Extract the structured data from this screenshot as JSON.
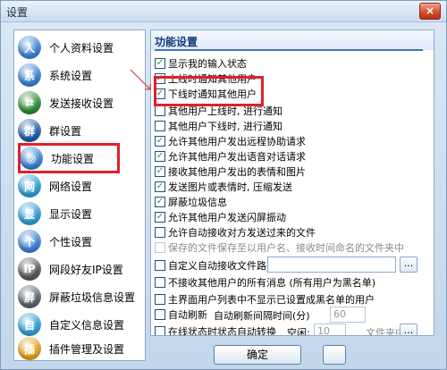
{
  "window": {
    "title": "设置",
    "close_glyph": "×"
  },
  "sidebar": {
    "items": [
      {
        "label": "个人资料设置",
        "icon": "person-icon",
        "color": "#3b83d6",
        "glyph": "人"
      },
      {
        "label": "系统设置",
        "icon": "system-icon",
        "color": "#3b83d6",
        "glyph": "系"
      },
      {
        "label": "发送接收设置",
        "icon": "send-receive-icon",
        "color": "#2f8c3a",
        "glyph": "⇄"
      },
      {
        "label": "群设置",
        "icon": "group-icon",
        "color": "#1d5fad",
        "glyph": "群"
      },
      {
        "label": "功能设置",
        "icon": "function-icon",
        "color": "#3b83d6",
        "glyph": "◎"
      },
      {
        "label": "网络设置",
        "icon": "network-icon",
        "color": "#2f9fd6",
        "glyph": "网"
      },
      {
        "label": "显示设置",
        "icon": "display-icon",
        "color": "#2f9fd6",
        "glyph": "显"
      },
      {
        "label": "个性设置",
        "icon": "personalize-icon",
        "color": "#3b83d6",
        "glyph": "个"
      },
      {
        "label": "网段好友IP设置",
        "icon": "ip-icon",
        "color": "#5a5a5a",
        "glyph": "IP"
      },
      {
        "label": "屏蔽垃圾信息设置",
        "icon": "block-spam-icon",
        "color": "#5a6470",
        "glyph": "屏"
      },
      {
        "label": "自定义信息设置",
        "icon": "custom-info-icon",
        "color": "#2f9fd6",
        "glyph": "自"
      },
      {
        "label": "插件管理及设置",
        "icon": "plugin-icon",
        "color": "#e5a21f",
        "glyph": "插"
      }
    ],
    "selected_index": 4
  },
  "panel": {
    "title": "功能设置",
    "options": [
      {
        "label": "显示我的输入状态",
        "checked": true
      },
      {
        "label": "上线时通知其他用户",
        "checked": true
      },
      {
        "label": "下线时通知其他用户",
        "checked": true
      },
      {
        "label": "其他用户上线时, 进行通知",
        "checked": false
      },
      {
        "label": "其他用户下线时, 进行通知",
        "checked": false
      },
      {
        "label": "允许其他用户发出远程协助请求",
        "checked": true
      },
      {
        "label": "允许其他用户发出语音对话请求",
        "checked": true
      },
      {
        "label": "接收其他用户发出的表情和图片",
        "checked": true
      },
      {
        "label": "发送图片或表情时, 压缩发送",
        "checked": true
      },
      {
        "label": "屏蔽垃圾信息",
        "checked": true
      },
      {
        "label": "允许其他用户发送闪屏振动",
        "checked": true
      },
      {
        "label": "允许自动接收对方发送过来的文件",
        "checked": false
      },
      {
        "label": "保存的文件保存至以用户名、接收时间命名的文件夹中",
        "checked": false,
        "disabled": true
      },
      {
        "label": "自定义自动接收文件路径",
        "checked": false
      },
      {
        "label": "不接收其他用户的所有消息 (所有用户为黑名单)",
        "checked": false
      },
      {
        "label": "主界面用户列表中不显示已设置成黑名单的用户",
        "checked": false
      },
      {
        "label": "自动刷新",
        "checked": false
      },
      {
        "label": "在线状态时状态自动转换",
        "checked": false
      }
    ],
    "auto_refresh_interval_label": "自动刷新间隔时间(分)",
    "auto_refresh_interval_value": "60",
    "idle_label": "空闲:",
    "idle_value": "10",
    "folder_tail_text": "文件夹中",
    "browse_label": "...",
    "check_glyph": "✓"
  },
  "footer": {
    "ok_label": "确定"
  }
}
